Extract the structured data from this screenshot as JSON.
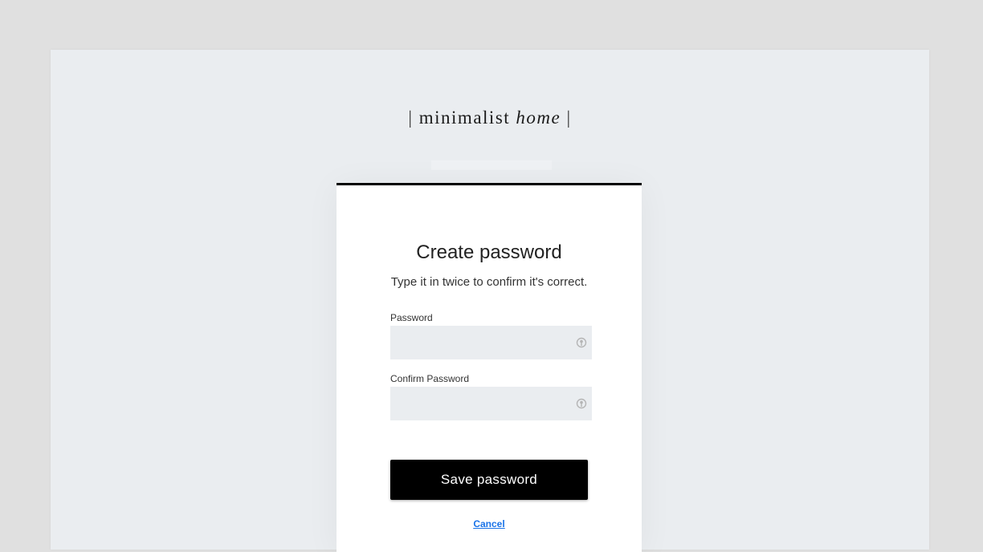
{
  "brand": {
    "bar_left": "|",
    "word1": "minimalist",
    "word2": "home",
    "bar_right": "|"
  },
  "form": {
    "title": "Create password",
    "subtitle": "Type it in twice to confirm it's correct.",
    "password_label": "Password",
    "password_value": "",
    "confirm_label": "Confirm Password",
    "confirm_value": "",
    "save_label": "Save password",
    "cancel_label": "Cancel"
  },
  "icons": {
    "password_toggle": "key-icon",
    "confirm_toggle": "key-icon"
  },
  "colors": {
    "accent": "#000000",
    "link": "#1a73e8",
    "field_bg": "#eaedf0",
    "page_bg": "#eaedf0"
  }
}
